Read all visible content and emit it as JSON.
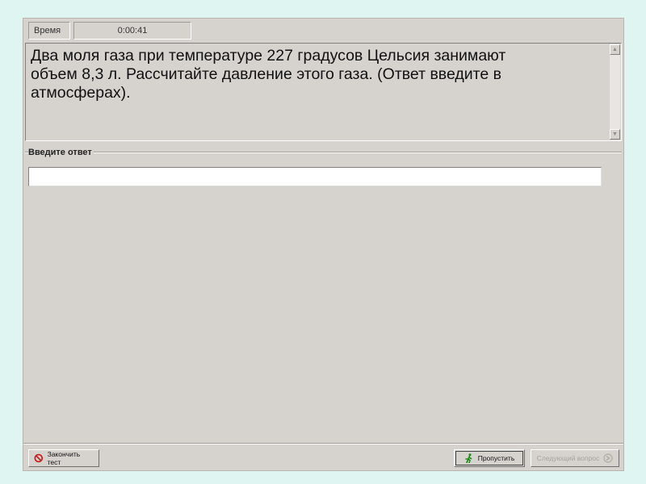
{
  "timer": {
    "label": "Время",
    "value": "0:00:41"
  },
  "question": {
    "text": "Два моля газа при температуре 227 градусов Цельсия занимают\nобъем 8,3 л.  Рассчитайте давление этого газа. (Ответ введите в\nатмосферах)."
  },
  "answer": {
    "label": "Введите ответ",
    "value": ""
  },
  "buttons": {
    "finish_label": "Закончить тест",
    "skip_label": "Пропустить",
    "next_label": "Следующий вопрос"
  },
  "colors": {
    "background": "#dff5f1",
    "panel": "#d6d3ce",
    "stop_icon": "#cc1f1f",
    "skip_icon": "#1a8c1a"
  },
  "icons": {
    "finish": "stop-icon",
    "skip": "running-man-icon",
    "next": "forward-icon",
    "scroll_up": "arrow-up-icon",
    "scroll_down": "arrow-down-icon"
  }
}
